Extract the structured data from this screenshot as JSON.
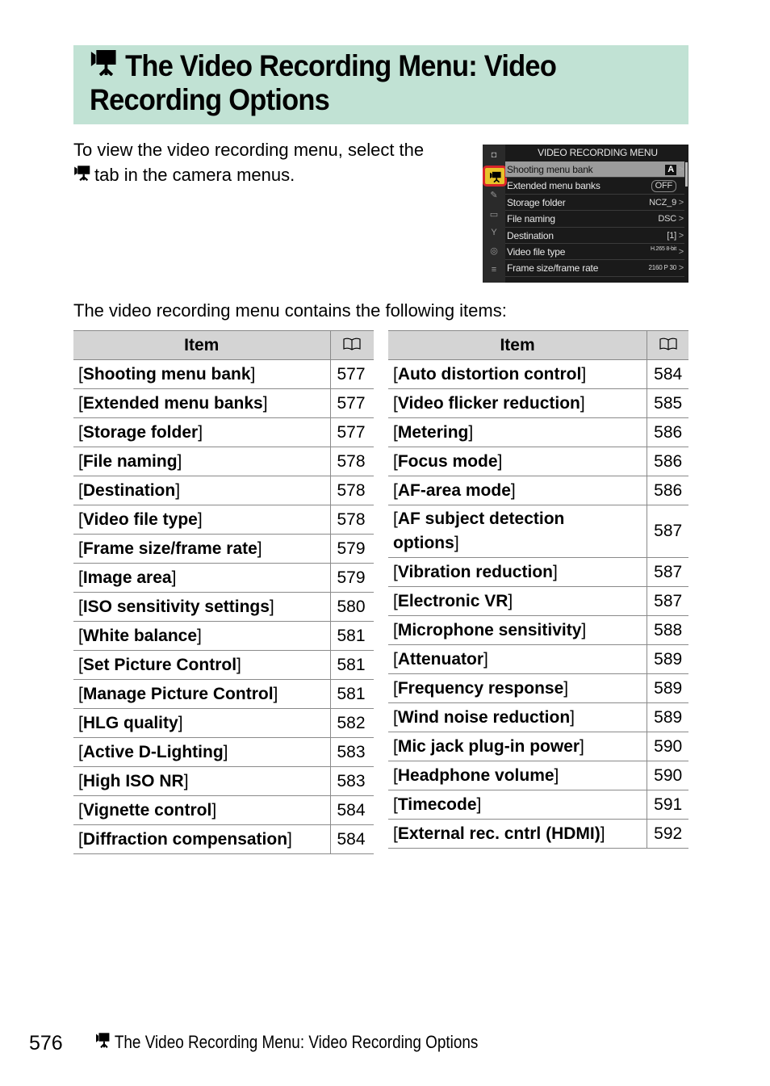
{
  "header": {
    "title": "The Video Recording Menu: Video Recording Options",
    "title_icon": "movie-camera-icon",
    "background_color": "#c1e2d4"
  },
  "intro": {
    "text_before_icon": "To view the video recording menu, select the",
    "text_after_icon": "tab in the camera menus.",
    "icon": "movie-camera-icon"
  },
  "camera_screen": {
    "menu_title": "VIDEO RECORDING MENU",
    "sidebar_icons": [
      "camera-icon",
      "movie-camera-icon",
      "pencil-icon",
      "playback-icon",
      "wrench-icon",
      "network-icon",
      "my-menu-icon"
    ],
    "active_tab": "movie-camera-icon",
    "highlight_color": "#d9252b",
    "rows": [
      {
        "label": "Shooting menu bank",
        "value": "A",
        "selected": true
      },
      {
        "label": "Extended menu banks",
        "value": "OFF"
      },
      {
        "label": "Storage folder",
        "value": "NCZ_9"
      },
      {
        "label": "File naming",
        "value": "DSC"
      },
      {
        "label": "Destination",
        "value": "[1]"
      },
      {
        "label": "Video file type",
        "value": "H.265 8-bit"
      },
      {
        "label": "Frame size/frame rate",
        "value": "2160 P 30"
      }
    ]
  },
  "lead_text": "The video recording menu contains the following items:",
  "table_header": {
    "item": "Item",
    "page_icon": "book-icon"
  },
  "tables": {
    "left": [
      {
        "name": "Shooting menu bank",
        "page": "577"
      },
      {
        "name": "Extended menu banks",
        "page": "577"
      },
      {
        "name": "Storage folder",
        "page": "577"
      },
      {
        "name": "File naming",
        "page": "578"
      },
      {
        "name": "Destination",
        "page": "578"
      },
      {
        "name": "Video file type",
        "page": "578"
      },
      {
        "name": "Frame size/frame rate",
        "page": "579"
      },
      {
        "name": "Image area",
        "page": "579"
      },
      {
        "name": "ISO sensitivity settings",
        "page": "580"
      },
      {
        "name": "White balance",
        "page": "581"
      },
      {
        "name": "Set Picture Control",
        "page": "581"
      },
      {
        "name": "Manage Picture Control",
        "page": "581"
      },
      {
        "name": "HLG quality",
        "page": "582"
      },
      {
        "name": "Active D-Lighting",
        "page": "583"
      },
      {
        "name": "High ISO NR",
        "page": "583"
      },
      {
        "name": "Vignette control",
        "page": "584"
      },
      {
        "name": "Diffraction compensation",
        "page": "584"
      }
    ],
    "right": [
      {
        "name": "Auto distortion control",
        "page": "584"
      },
      {
        "name": "Video flicker reduction",
        "page": "585"
      },
      {
        "name": "Metering",
        "page": "586"
      },
      {
        "name": "Focus mode",
        "page": "586"
      },
      {
        "name": "AF-area mode",
        "page": "586"
      },
      {
        "name": "AF subject detection options",
        "page": "587",
        "wrap": true
      },
      {
        "name": "Vibration reduction",
        "page": "587"
      },
      {
        "name": "Electronic VR",
        "page": "587"
      },
      {
        "name": "Microphone sensitivity",
        "page": "588"
      },
      {
        "name": "Attenuator",
        "page": "589"
      },
      {
        "name": "Frequency response",
        "page": "589"
      },
      {
        "name": "Wind noise reduction",
        "page": "589"
      },
      {
        "name": "Mic jack plug-in power",
        "page": "590"
      },
      {
        "name": "Headphone volume",
        "page": "590"
      },
      {
        "name": "Timecode",
        "page": "591"
      },
      {
        "name": "External rec. cntrl (HDMI)",
        "page": "592"
      }
    ]
  },
  "footer": {
    "page_number": "576",
    "running_title": "The Video Recording Menu: Video Recording Options"
  }
}
